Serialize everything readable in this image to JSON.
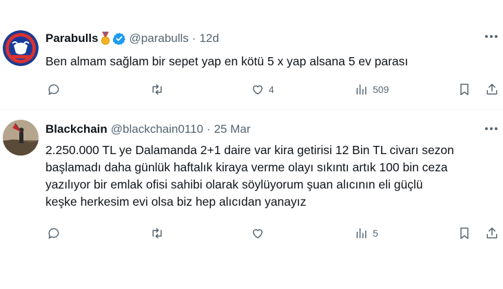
{
  "tweets": [
    {
      "name": "Parabulls",
      "handle": "@parabulls",
      "dot": "·",
      "time": "12d",
      "lines": [
        "Ben almam sağlam bir sepet yap en kötü 5 x yap alsana 5 ev parası"
      ],
      "likes": "4",
      "views": "509",
      "verified": true,
      "medal": true
    },
    {
      "name": "Blackchain",
      "handle": "@blackchain0110",
      "dot": "·",
      "time": "25 Mar",
      "lines": [
        "2.250.000 TL ye Dalamanda 2+1 daire var kira getirisi 12 Bin TL civarı sezon",
        "başlamadı daha günlük haftalık kiraya verme olayı sıkıntı artık 100 bin ceza",
        "yazılıyor bir emlak ofisi sahibi olarak söylüyorum şuan alıcının eli güçlü",
        "keşke herkesim evi olsa biz hep alıcıdan yanayız"
      ],
      "likes": "",
      "views": "5"
    }
  ],
  "colors": {
    "text": "#0f1419",
    "secondary": "#536471",
    "verified": "#1d9bf0",
    "divider": "#eff3f4"
  }
}
